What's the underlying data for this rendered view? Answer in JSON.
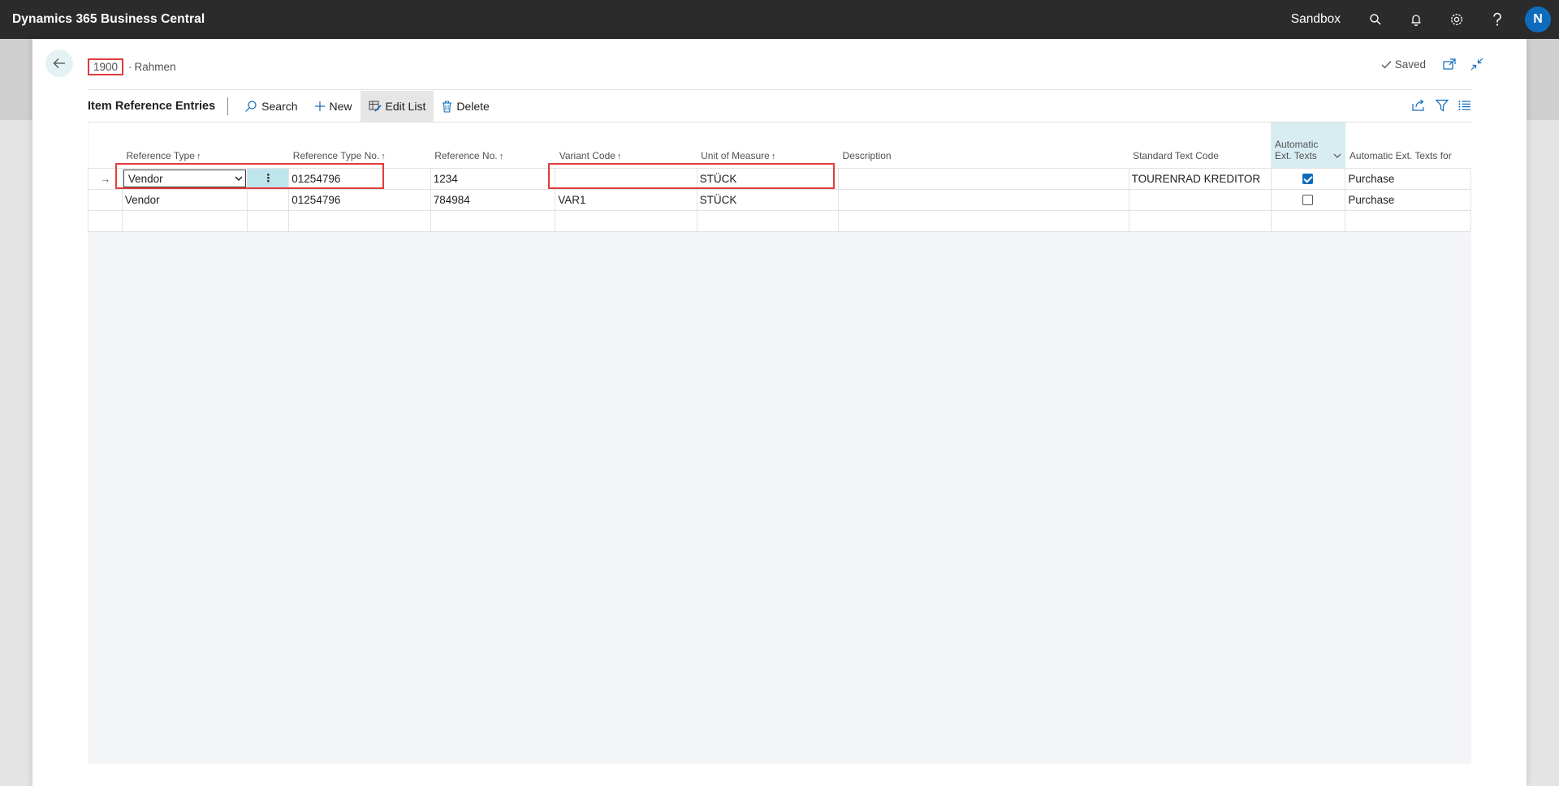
{
  "appbar": {
    "title": "Dynamics 365 Business Central",
    "environment": "Sandbox",
    "avatar_initial": "N",
    "icons": [
      "search-icon",
      "bell-icon",
      "gear-icon",
      "help-icon"
    ]
  },
  "header": {
    "item_no": "1900",
    "separator": "·",
    "item_name": "Rahmen",
    "saved_label": "Saved"
  },
  "actionbar": {
    "page_caption": "Item Reference Entries",
    "search_label": "Search",
    "new_label": "New",
    "edit_list_label": "Edit List",
    "delete_label": "Delete"
  },
  "grid": {
    "columns": {
      "reference_type": "Reference Type",
      "reference_type_no": "Reference Type No.",
      "reference_no": "Reference No.",
      "variant_code": "Variant Code",
      "unit_of_measure": "Unit of Measure",
      "description": "Description",
      "standard_text_code": "Standard Text Code",
      "automatic_ext_texts_line1": "Automatic",
      "automatic_ext_texts_line2": "Ext. Texts",
      "automatic_ext_texts_for": "Automatic Ext. Texts for"
    },
    "rows": [
      {
        "reference_type": "Vendor",
        "reference_type_no": "01254796",
        "reference_no": "1234",
        "variant_code": "",
        "unit_of_measure": "STÜCK",
        "description": "",
        "standard_text_code": "TOURENRAD KREDITOR",
        "automatic_ext_texts": true,
        "automatic_ext_texts_for": "Purchase"
      },
      {
        "reference_type": "Vendor",
        "reference_type_no": "01254796",
        "reference_no": "784984",
        "variant_code": "VAR1",
        "unit_of_measure": "STÜCK",
        "description": "",
        "standard_text_code": "",
        "automatic_ext_texts": false,
        "automatic_ext_texts_for": "Purchase"
      }
    ],
    "sort_arrow": "↑",
    "row_arrow": "→",
    "kebab": "⋮"
  },
  "colors": {
    "appbar_bg": "#2b2b2b",
    "accent": "#0f6cbd",
    "annotation": "#e03c3c",
    "selected_cell": "#bfe5ec"
  }
}
